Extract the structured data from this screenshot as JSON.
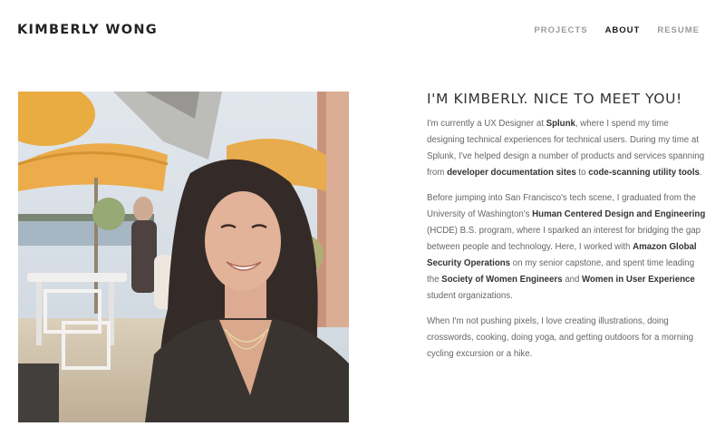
{
  "header": {
    "site_title": "KIMBERLY WONG",
    "nav": [
      {
        "label": "PROJECTS",
        "active": false
      },
      {
        "label": "ABOUT",
        "active": true
      },
      {
        "label": "RESUME",
        "active": false
      }
    ]
  },
  "about": {
    "heading": "I'M KIMBERLY. NICE TO MEET YOU!",
    "p1": {
      "t1": "I'm currently a UX Designer at ",
      "b1": "Splunk",
      "t2": ", where I spend my time designing technical experiences for technical users.  During my time at Splunk, I've helped design a number of products and services spanning from ",
      "b2": "developer documentation sites",
      "t3": " to ",
      "b3": "code-scanning utility tools",
      "t4": "."
    },
    "p2": {
      "t1": "Before jumping into San Francisco's tech scene, I graduated from the University of Washington's ",
      "b1": "Human Centered Design and Engineering",
      "t2": " (HCDE) B.S. program, where I sparked an interest for bridging the gap between people and technology.  Here, I worked with ",
      "b2": "Amazon Global Security Operations",
      "t3": " on my senior capstone, and spent time leading the ",
      "b3": "Society of Women Engineers",
      "t4": " and ",
      "b4": "Women in User Experience",
      "t5": " student organizations."
    },
    "p3": "When I'm not pushing pixels, I love creating illustrations, doing crosswords, cooking, doing yoga, and getting outdoors for a morning cycling excursion or a hike."
  },
  "colors": {
    "background": "#ffffff",
    "title": "#222222",
    "nav_inactive": "#9b9b9b",
    "nav_active": "#1a1a1a",
    "body_text": "#666666",
    "bold_text": "#333333"
  }
}
